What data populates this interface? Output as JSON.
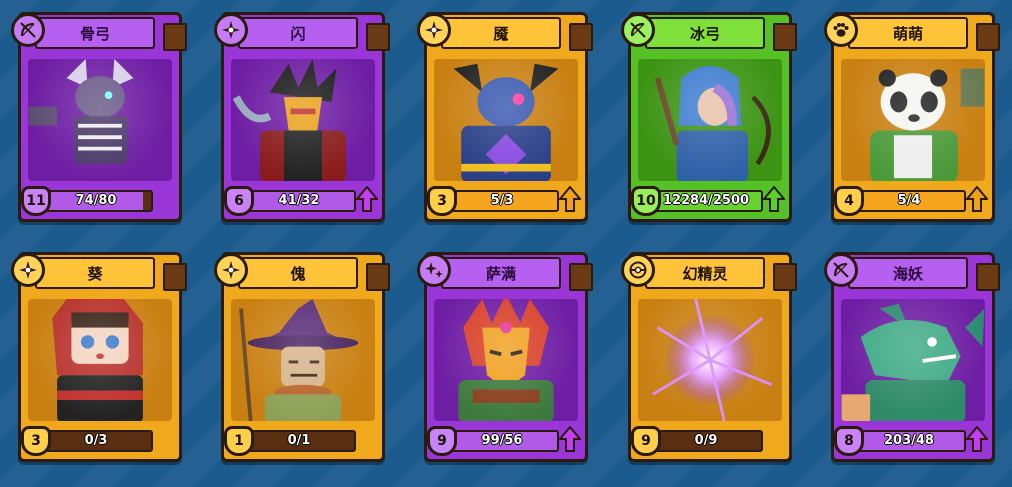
{
  "cards": [
    {
      "name": "骨弓",
      "level": "11",
      "progress": "74/80",
      "fill": 0.925,
      "rarity": "purple",
      "icon": "bow-icon",
      "upgrade": false
    },
    {
      "name": "闪",
      "level": "6",
      "progress": "41/32",
      "fill": 1,
      "rarity": "purple",
      "icon": "shuriken-icon",
      "upgrade": true
    },
    {
      "name": "魇",
      "level": "3",
      "progress": "5/3",
      "fill": 1,
      "rarity": "gold",
      "icon": "shuriken-icon",
      "upgrade": true
    },
    {
      "name": "冰弓",
      "level": "10",
      "progress": "12284/2500",
      "fill": 1,
      "rarity": "green",
      "icon": "bow-icon",
      "upgrade": true
    },
    {
      "name": "萌萌",
      "level": "4",
      "progress": "5/4",
      "fill": 1,
      "rarity": "gold",
      "icon": "paw-icon",
      "upgrade": true
    },
    {
      "name": "葵",
      "level": "3",
      "progress": "0/3",
      "fill": 0,
      "rarity": "gold",
      "icon": "shuriken-icon",
      "upgrade": false
    },
    {
      "name": "傀",
      "level": "1",
      "progress": "0/1",
      "fill": 0,
      "rarity": "gold",
      "icon": "shuriken-icon",
      "upgrade": false
    },
    {
      "name": "萨满",
      "level": "9",
      "progress": "99/56",
      "fill": 1,
      "rarity": "purple",
      "icon": "sparkle-icon",
      "upgrade": true
    },
    {
      "name": "幻精灵",
      "level": "9",
      "progress": "0/9",
      "fill": 0,
      "rarity": "gold",
      "icon": "orb-icon",
      "upgrade": false
    },
    {
      "name": "海妖",
      "level": "8",
      "progress": "203/48",
      "fill": 1,
      "rarity": "purple",
      "icon": "bow-icon",
      "upgrade": true
    }
  ]
}
